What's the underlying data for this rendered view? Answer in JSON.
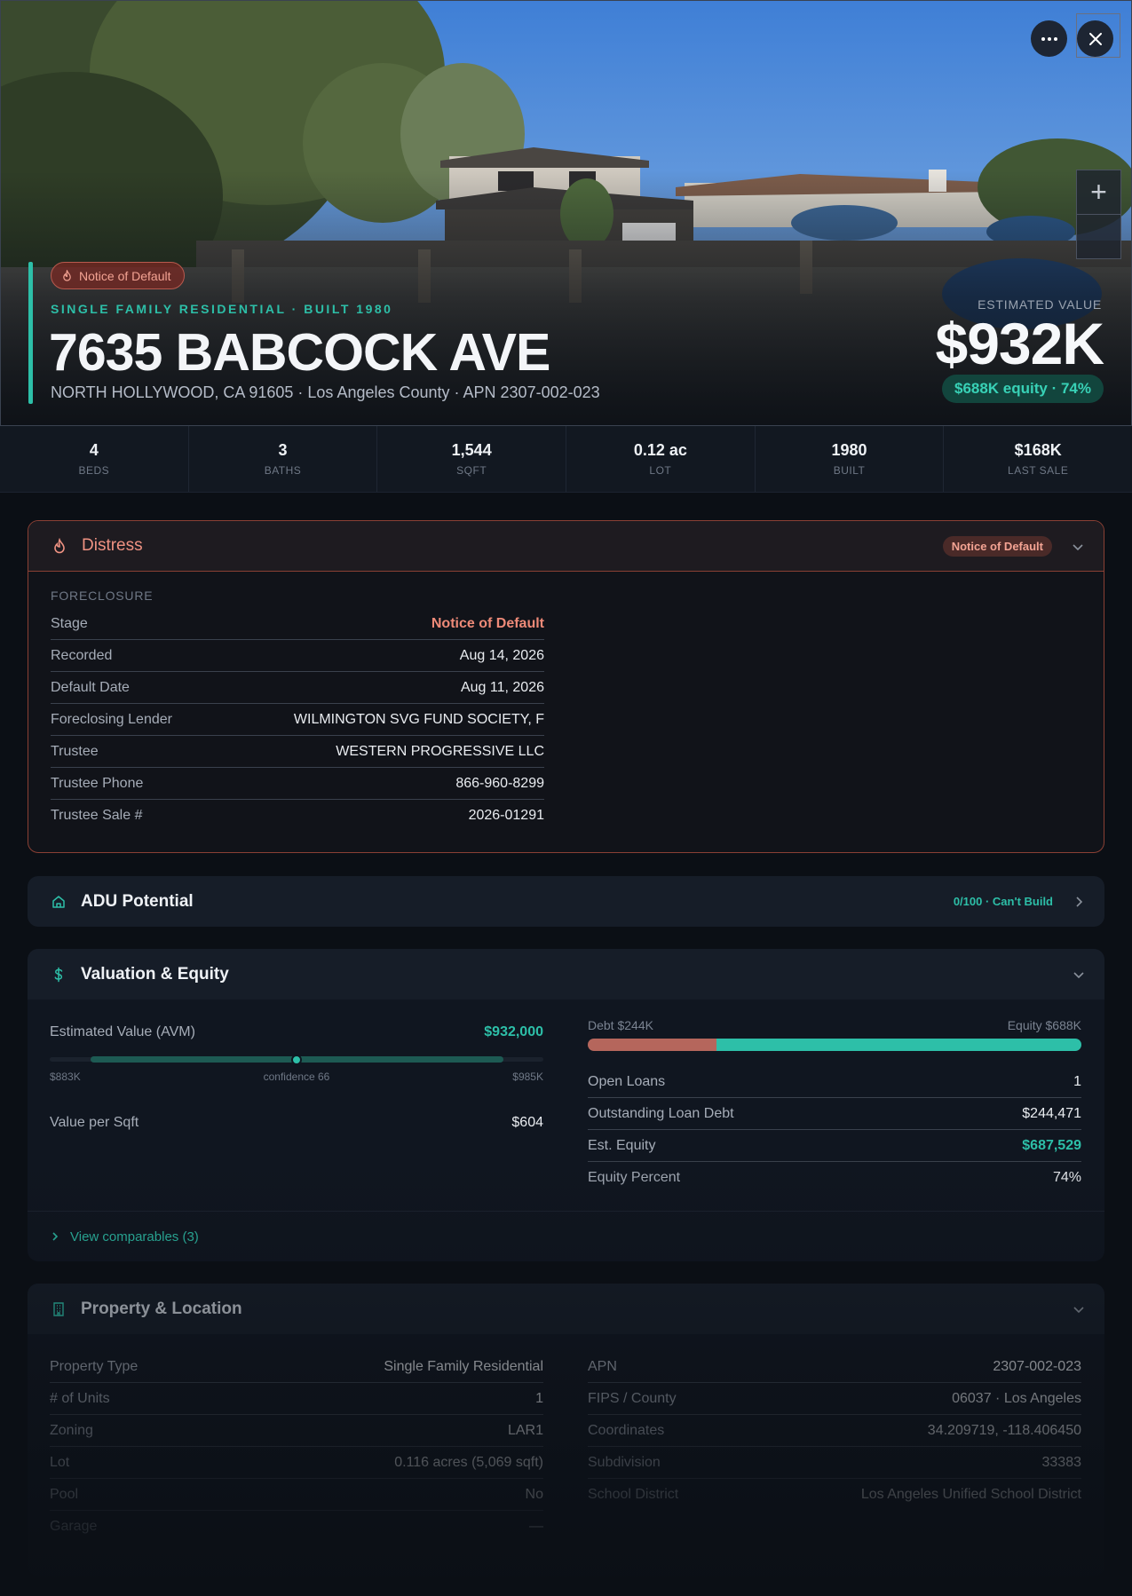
{
  "hero": {
    "status_badge": "Notice of Default",
    "subtitle": "SINGLE FAMILY RESIDENTIAL · BUILT 1980",
    "title": "7635 BABCOCK AVE",
    "address_line": "NORTH HOLLYWOOD, CA 91605 · Los Angeles County · APN 2307-002-023",
    "estimated_label": "ESTIMATED VALUE",
    "estimated_value": "$932K",
    "equity_pill": "$688K equity · 74%",
    "zoom_in": "+"
  },
  "stats": [
    {
      "value": "4",
      "label": "BEDS"
    },
    {
      "value": "3",
      "label": "BATHS"
    },
    {
      "value": "1,544",
      "label": "SQFT"
    },
    {
      "value": "0.12 ac",
      "label": "LOT"
    },
    {
      "value": "1980",
      "label": "BUILT"
    },
    {
      "value": "$168K",
      "label": "LAST SALE"
    }
  ],
  "distress": {
    "title": "Distress",
    "badge": "Notice of Default",
    "section": "FORECLOSURE",
    "rows": [
      {
        "k": "Stage",
        "v": "Notice of Default"
      },
      {
        "k": "Recorded",
        "v": "Aug 14, 2026"
      },
      {
        "k": "Default Date",
        "v": "Aug 11, 2026"
      },
      {
        "k": "Foreclosing Lender",
        "v": "WILMINGTON SVG FUND SOCIETY, F"
      },
      {
        "k": "Trustee",
        "v": "WESTERN PROGRESSIVE LLC"
      },
      {
        "k": "Trustee Phone",
        "v": "866-960-8299"
      },
      {
        "k": "Trustee Sale #",
        "v": "2026-01291"
      }
    ]
  },
  "adu": {
    "title": "ADU Potential",
    "score": "0/100 · Can't Build"
  },
  "valuation": {
    "title": "Valuation & Equity",
    "avm_label": "Estimated Value (AVM)",
    "avm_value": "$932,000",
    "range_low": "$883K",
    "range_mid": "confidence 66",
    "range_high": "$985K",
    "value_per_sqft_label": "Value per Sqft",
    "value_per_sqft": "$604",
    "debt_label": "Debt $244K",
    "equity_label": "Equity $688K",
    "equity_fraction": 0.74,
    "rows": [
      {
        "k": "Open Loans",
        "v": "1"
      },
      {
        "k": "Outstanding Loan Debt",
        "v": "$244,471"
      },
      {
        "k": "Est. Equity",
        "v": "$687,529"
      },
      {
        "k": "Equity Percent",
        "v": "74%"
      }
    ],
    "comparables_link": "View comparables (3)"
  },
  "property": {
    "title": "Property & Location",
    "left_rows": [
      {
        "k": "Property Type",
        "v": "Single Family Residential"
      },
      {
        "k": "# of Units",
        "v": "1"
      },
      {
        "k": "Zoning",
        "v": "LAR1"
      },
      {
        "k": "Lot",
        "v": "0.116 acres (5,069 sqft)"
      },
      {
        "k": "Pool",
        "v": "No"
      },
      {
        "k": "Garage",
        "v": "—"
      }
    ],
    "right_rows": [
      {
        "k": "APN",
        "v": "2307-002-023"
      },
      {
        "k": "FIPS / County",
        "v": "06037 · Los Angeles"
      },
      {
        "k": "Coordinates",
        "v": "34.209719, -118.406450"
      },
      {
        "k": "Subdivision",
        "v": "33383"
      },
      {
        "k": "School District",
        "v": "Los Angeles Unified School District"
      }
    ]
  },
  "colors": {
    "accent": "#2dbfa8",
    "distress": "#ef9282",
    "background": "#0b0f15"
  },
  "icons": [
    "more-icon",
    "close-icon",
    "flame-icon",
    "home-icon",
    "dollar-icon",
    "building-icon",
    "chevron-down-icon",
    "chevron-right-icon"
  ]
}
